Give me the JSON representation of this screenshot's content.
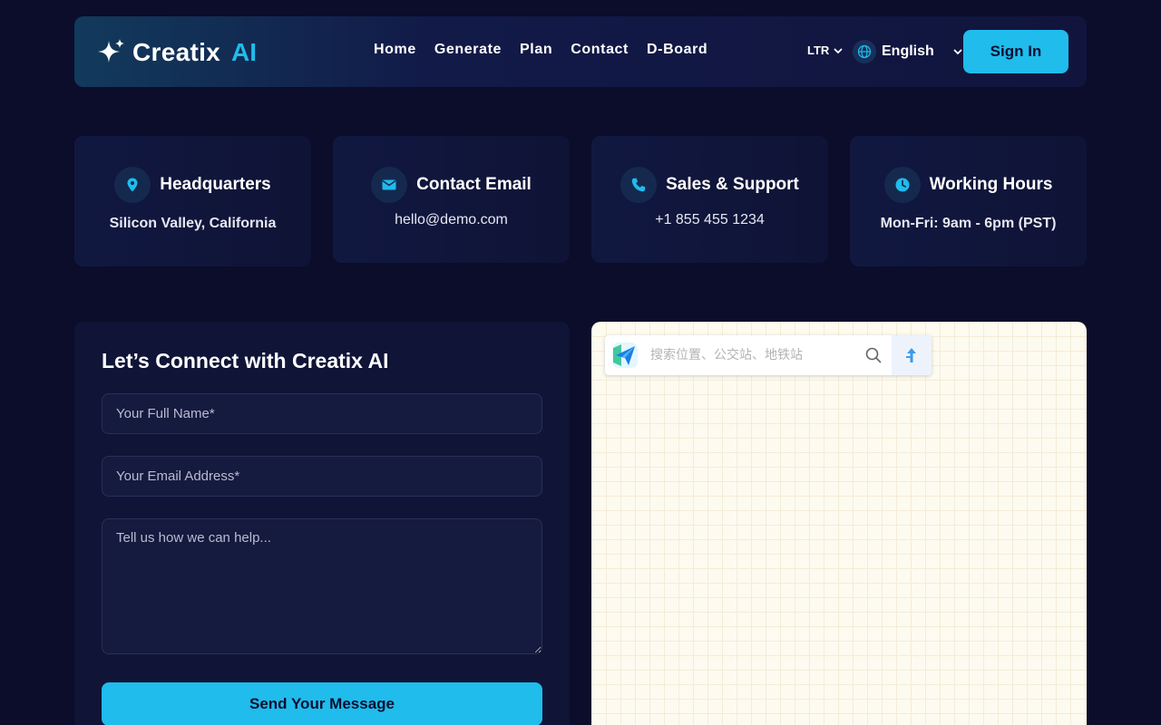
{
  "brand": {
    "name": "Creatix",
    "suffix": "AI"
  },
  "nav": {
    "items": [
      {
        "label": "Home"
      },
      {
        "label": "Generate"
      },
      {
        "label": "Plan"
      },
      {
        "label": "Contact"
      },
      {
        "label": "D-Board"
      }
    ]
  },
  "header": {
    "direction": "LTR",
    "language": "English",
    "signin_label": "Sign In"
  },
  "info_cards": [
    {
      "icon": "location-pin-icon",
      "title": "Headquarters",
      "value": "Silicon Valley, California"
    },
    {
      "icon": "mail-icon",
      "title": "Contact Email",
      "value": "hello@demo.com"
    },
    {
      "icon": "phone-icon",
      "title": "Sales & Support",
      "value": "+1 855 455 1234"
    },
    {
      "icon": "clock-icon",
      "title": "Working Hours",
      "value": "Mon-Fri: 9am - 6pm (PST)"
    }
  ],
  "form": {
    "title": "Let’s Connect with Creatix AI",
    "name_placeholder": "Your Full Name*",
    "email_placeholder": "Your Email Address*",
    "message_placeholder": "Tell us how we can help...",
    "submit_label": "Send Your Message"
  },
  "map": {
    "search_placeholder": "搜索位置、公交站、地铁站"
  },
  "colors": {
    "accent": "#1fbcec",
    "background": "#0b0d2a",
    "card": "#101437"
  }
}
